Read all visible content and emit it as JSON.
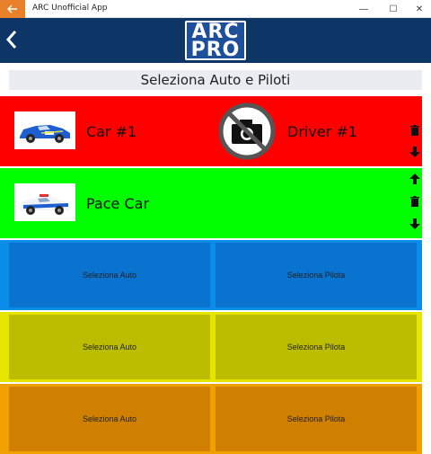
{
  "window": {
    "title": "ARC Unofficial App",
    "minimize": "—",
    "maximize": "☐",
    "close": "✕"
  },
  "header": {
    "logo_line1": "ARC",
    "logo_line2": "PRO"
  },
  "page": {
    "title": "Seleziona Auto e Piloti"
  },
  "selected": [
    {
      "car": "Car #1",
      "driver": "Driver #1",
      "color": "#ff0000"
    },
    {
      "car": "Pace Car",
      "driver": "",
      "color": "#00ff00"
    }
  ],
  "slots": [
    {
      "car": "Seleziona Auto",
      "driver": "Seleziona Pilota",
      "outer": "#0a8de8",
      "inner": "#0a72cf"
    },
    {
      "car": "Seleziona Auto",
      "driver": "Seleziona Pilota",
      "outer": "#e5e500",
      "inner": "#bcbc00"
    },
    {
      "car": "Seleziona Auto",
      "driver": "Seleziona Pilota",
      "outer": "#f0a000",
      "inner": "#cf8000"
    }
  ]
}
